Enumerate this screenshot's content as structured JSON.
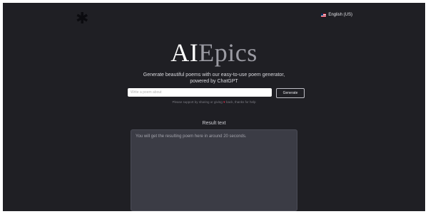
{
  "header": {
    "logo_glyph": "✱",
    "language_label": "English (US)",
    "language_flag_icon": "us-flag-icon"
  },
  "hero": {
    "title_part1": "AI",
    "title_part2": "Epics",
    "subtitle": "Generate beautiful poems with our easy-to-use poem generator, powered by ChatGPT"
  },
  "form": {
    "input_placeholder": "Write a poem about",
    "generate_label": "Generate"
  },
  "support": {
    "before": "Please support by sharing or giving",
    "heart": "♥",
    "after": "back, thanks for help"
  },
  "result": {
    "label": "Result text",
    "placeholder": "You will get the resulting poem here in around 20 seconds."
  },
  "colors": {
    "background": "#1f1f24",
    "panel": "#3b3c45",
    "title_secondary": "#9b9ba3",
    "heart": "#d0314a"
  }
}
